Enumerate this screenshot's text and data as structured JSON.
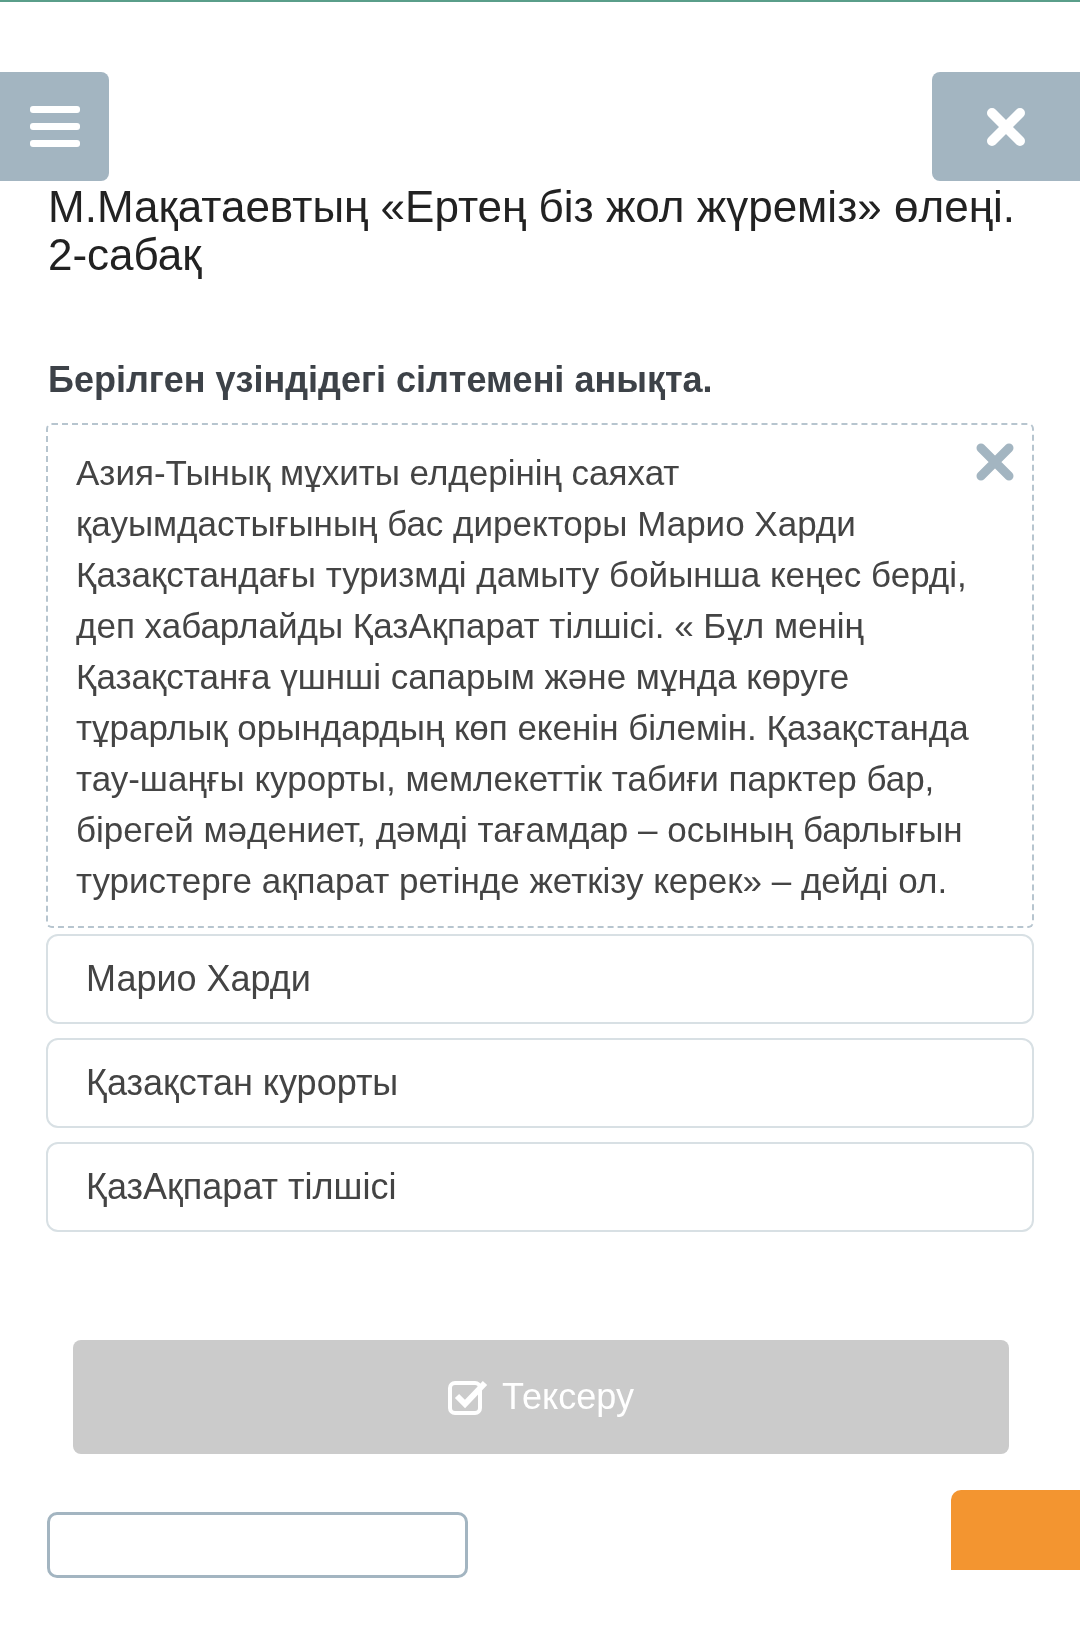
{
  "header": {
    "title": "М.Мақатаевтың «Ертең біз жол жүреміз» өлеңі. 2-сабақ"
  },
  "question": {
    "prompt": "Берілген үзіндідегі сілтемені анықта.",
    "passage": "Азия-Тынық мұхиты елдерінің саяхат қауымдастығының бас директоры Марио Харди Қазақстандағы туризмді дамыту бойынша кеңес берді, деп хабарлайды ҚазАқпарат тілшісі. « Бұл менің Қазақстанға үшнші сапарым және мұнда көруге тұрарлық орындардың көп екенін білемін. Қазақстанда тау-шаңғы курорты, мемлекеттік табиғи парктер бар, бірегей мәдениет, дәмді тағамдар – осының барлығын туристерге ақпарат ретінде жеткізу керек» – дейді ол.",
    "options": [
      {
        "label": "Марио Харди",
        "selected": false
      },
      {
        "label": "Қазақстан курорты",
        "selected": false
      },
      {
        "label": "ҚазАқпарат тілшісі",
        "selected": false
      }
    ]
  },
  "check_button": {
    "label": "Тексеру",
    "disabled": true
  }
}
